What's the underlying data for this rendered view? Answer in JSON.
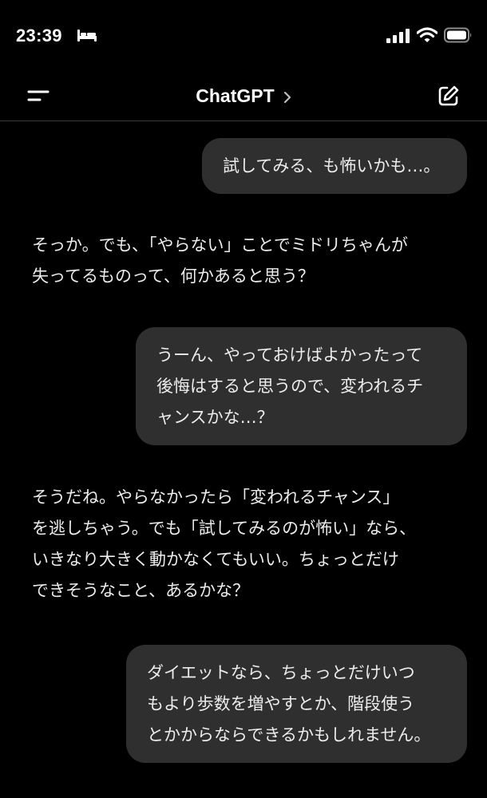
{
  "status_bar": {
    "time": "23:39"
  },
  "header": {
    "title": "ChatGPT"
  },
  "messages": [
    {
      "role": "user",
      "lines": [
        "試してみる、も怖いかも…。"
      ]
    },
    {
      "role": "assistant",
      "lines": [
        "そっか。でも、「やらない」ことでミドリちゃんが",
        "失ってるものって、何かあると思う？"
      ]
    },
    {
      "role": "user",
      "lines": [
        "うーん、やっておけばよかったって",
        "後悔はすると思うので、変われるチ",
        "ャンスかな…？"
      ]
    },
    {
      "role": "assistant",
      "lines": [
        "そうだね。やらなかったら「変われるチャンス」",
        "を逃しちゃう。でも「試してみるのが怖い」なら、",
        "いきなり大きく動かなくてもいい。ちょっとだけ",
        "できそうなこと、あるかな？"
      ]
    },
    {
      "role": "user",
      "lines": [
        "ダイエットなら、ちょっとだけいつ",
        "もより歩数を増やすとか、階段使う",
        "とかからならできるかもしれません。"
      ]
    }
  ],
  "icons": {
    "status": [
      "bed-icon",
      "cellular-signal-icon",
      "wifi-icon",
      "battery-icon"
    ],
    "header": [
      "menu-icon",
      "chevron-right-icon",
      "new-chat-icon"
    ]
  },
  "colors": {
    "background": "#000000",
    "user_bubble": "#2f2f2f",
    "text": "#ececec",
    "divider": "#3a3a3c"
  }
}
